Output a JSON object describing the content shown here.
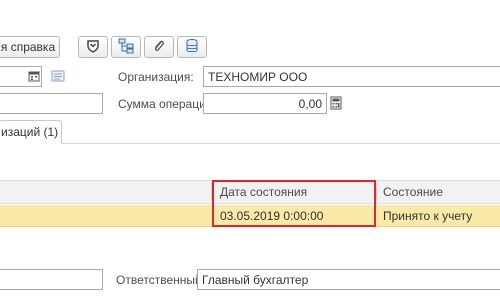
{
  "toolbar": {
    "report_button_label": "я справка",
    "icons": [
      "shield-icon",
      "structure-icon",
      "attachment-icon",
      "database-icon"
    ]
  },
  "form": {
    "organization_label": "Организация:",
    "organization_value": "ТЕХНОМИР ООО",
    "amount_label": "Сумма операции:",
    "amount_value": "0,00",
    "responsible_label": "Ответственный:",
    "responsible_value": "Главный бухгалтер"
  },
  "tab": {
    "label": "изаций (1)"
  },
  "table": {
    "columns": [
      "Дата состояния",
      "Состояние"
    ],
    "rows": [
      {
        "date": "03.05.2019 0:00:00",
        "state": "Принято к учету"
      }
    ]
  },
  "colors": {
    "header_bg": "#f2f2f2",
    "row_highlight": "#fbe9a8",
    "selected_cell_border": "#e0262c",
    "tab_line": "#d6d6d6"
  }
}
